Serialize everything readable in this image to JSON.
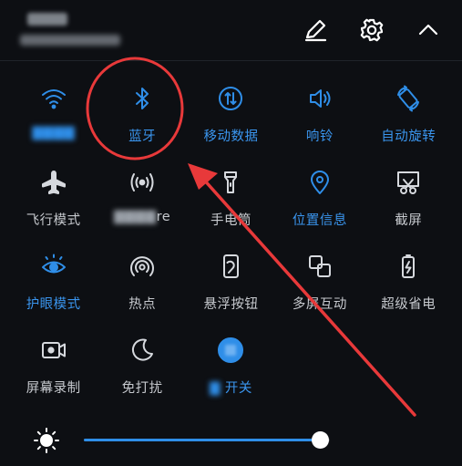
{
  "header": {
    "edit_icon": "pencil-icon",
    "settings_icon": "gear-icon",
    "collapse_icon": "chevron-up-icon"
  },
  "tiles": [
    {
      "label": "",
      "state": "on",
      "icon": "wifi-icon"
    },
    {
      "label": "蓝牙",
      "state": "on",
      "icon": "bluetooth-icon"
    },
    {
      "label": "移动数据",
      "state": "on",
      "icon": "mobile-data-icon"
    },
    {
      "label": "响铃",
      "state": "on",
      "icon": "speaker-icon"
    },
    {
      "label": "自动旋转",
      "state": "on",
      "icon": "auto-rotate-icon"
    },
    {
      "label": "飞行模式",
      "state": "off",
      "icon": "airplane-icon"
    },
    {
      "label": "re",
      "state": "off",
      "icon": "hotspot-share-icon"
    },
    {
      "label": "手电筒",
      "state": "off",
      "icon": "flashlight-icon"
    },
    {
      "label": "位置信息",
      "state": "on",
      "icon": "location-icon"
    },
    {
      "label": "截屏",
      "state": "off",
      "icon": "screenshot-icon"
    },
    {
      "label": "护眼模式",
      "state": "on",
      "icon": "eye-icon"
    },
    {
      "label": "热点",
      "state": "off",
      "icon": "hotspot-icon"
    },
    {
      "label": "悬浮按钮",
      "state": "off",
      "icon": "floating-button-icon"
    },
    {
      "label": "多屏互动",
      "state": "off",
      "icon": "multi-screen-icon"
    },
    {
      "label": "超级省电",
      "state": "off",
      "icon": "battery-saver-icon"
    },
    {
      "label": "屏幕录制",
      "state": "off",
      "icon": "screen-record-icon"
    },
    {
      "label": "免打扰",
      "state": "off",
      "icon": "moon-icon"
    },
    {
      "label": "开关",
      "state": "on",
      "icon": "nfc-icon"
    }
  ],
  "brightness": {
    "icon": "sun-icon",
    "level": 0.96,
    "colors": {
      "fill": "#2f8ee8",
      "track": "#30353d"
    }
  },
  "colors": {
    "accent": "#2f8ee8",
    "annotation": "#e8393a",
    "background": "#0d0f13"
  }
}
